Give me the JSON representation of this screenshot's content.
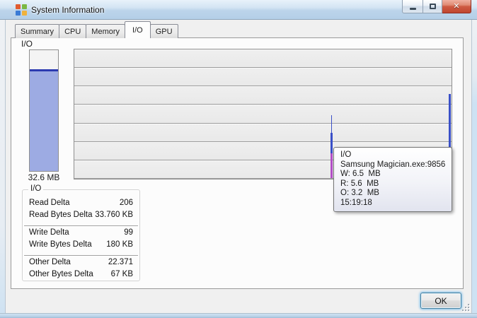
{
  "window": {
    "title": "System Information",
    "caption_buttons": {
      "minimize": "minimize",
      "maximize": "maximize",
      "close": "close"
    }
  },
  "colors": {
    "titlebar_glass": "#b9d1ea",
    "close_button": "#cf5c43",
    "gauge_fill": "#9dabe3",
    "gauge_fill_top_line": "#2b3ab0",
    "spike_blue": "#3a50c8",
    "spike_magenta": "#b44fc8",
    "chart_row_bg": "#ececec"
  },
  "tabs": {
    "items": [
      {
        "label": "Summary",
        "active": false
      },
      {
        "label": "CPU",
        "active": false
      },
      {
        "label": "Memory",
        "active": false
      },
      {
        "label": "I/O",
        "active": true
      },
      {
        "label": "GPU",
        "active": false
      }
    ]
  },
  "io_tab": {
    "section_label": "I/O",
    "gauge": {
      "value_label": "32.6  MB",
      "fill_percent": 84,
      "fill_color": "#9dabe3",
      "fill_top_line_color": "#2b3ab0"
    },
    "history_chart": {
      "rows": 7,
      "spikes": [
        {
          "x_pct": 68.2,
          "segments": [
            {
              "top_pct": 50.8,
              "height_pct": 13.5,
              "width": 1,
              "color": "#3a50c8"
            },
            {
              "top_pct": 64.3,
              "height_pct": 16.2,
              "width": 3,
              "color": "#3a50c8"
            },
            {
              "top_pct": 80.5,
              "height_pct": 19.0,
              "width": 3,
              "color": "#b44fc8"
            }
          ]
        },
        {
          "x_pct": 99.6,
          "segments": [
            {
              "top_pct": 34.6,
              "height_pct": 65.4,
              "width": 3,
              "color": "#3a50c8"
            }
          ]
        }
      ]
    },
    "tooltip": {
      "lines": [
        "I/O",
        "Samsung Magician.exe:9856",
        "W: 6.5  MB",
        "R: 5.6  MB",
        "O: 3.2  MB",
        "15:19:18"
      ]
    },
    "stats": {
      "group_label": "I/O",
      "rows": [
        {
          "label": "Read Delta",
          "value": "206",
          "sep_after": false
        },
        {
          "label": "Read Bytes Delta",
          "value": "33.760 KB",
          "sep_after": true
        },
        {
          "label": "Write Delta",
          "value": "99",
          "sep_after": false
        },
        {
          "label": "Write Bytes Delta",
          "value": "180 KB",
          "sep_after": true
        },
        {
          "label": "Other Delta",
          "value": "22.371",
          "sep_after": false
        },
        {
          "label": "Other Bytes Delta",
          "value": "67 KB",
          "sep_after": false
        }
      ]
    }
  },
  "footer": {
    "ok_label": "OK"
  }
}
